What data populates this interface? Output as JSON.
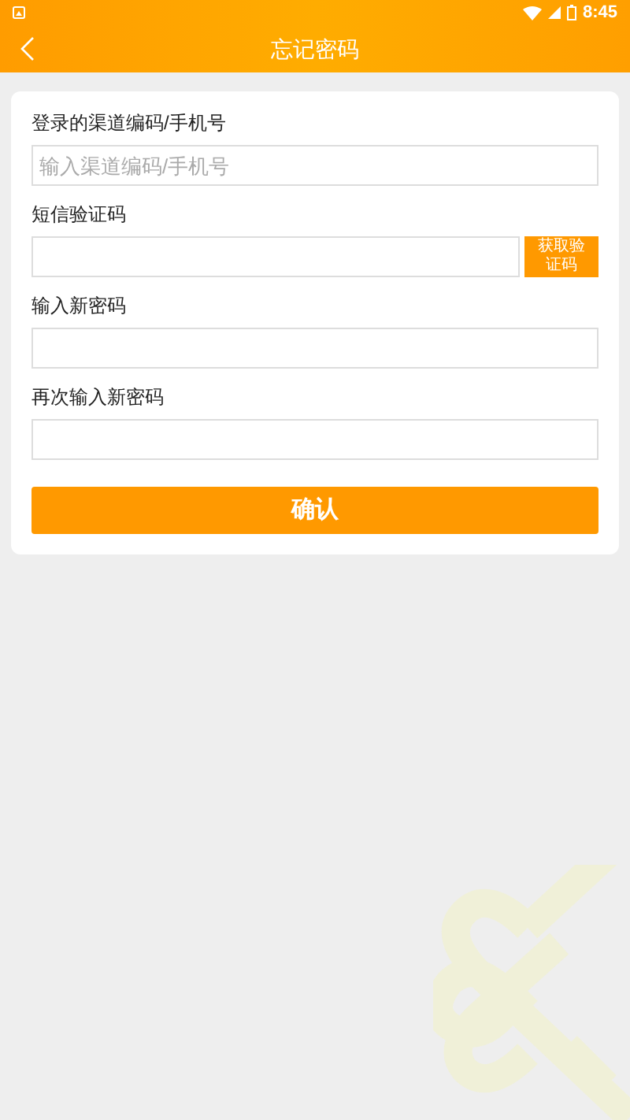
{
  "status_bar": {
    "time": "8:45"
  },
  "header": {
    "title": "忘记密码"
  },
  "form": {
    "fields": [
      {
        "kind": "input",
        "label": "登录的渠道编码/手机号",
        "placeholder": "输入渠道编码/手机号"
      },
      {
        "kind": "code",
        "label": "短信验证码",
        "button": "获取验证码"
      },
      {
        "kind": "input",
        "label": "输入新密码"
      },
      {
        "kind": "input",
        "label": "再次输入新密码"
      }
    ],
    "submit": "确认"
  }
}
